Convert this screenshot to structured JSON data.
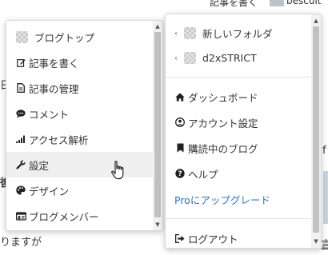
{
  "background": {
    "header_write": "記事を書く",
    "header_user": "bescuit",
    "left_char": "日",
    "left_char2": "後",
    "bottom_text": "りますが",
    "right_char": "f",
    "right_u": "言"
  },
  "left_menu": {
    "items": [
      {
        "label": "ブログトップ",
        "icon": "blog-thumbnail"
      },
      {
        "label": "記事を書く",
        "icon": "edit-icon"
      },
      {
        "label": "記事の管理",
        "icon": "document-icon"
      },
      {
        "label": "コメント",
        "icon": "comment-icon"
      },
      {
        "label": "アクセス解析",
        "icon": "chart-icon"
      },
      {
        "label": "設定",
        "icon": "wrench-icon"
      },
      {
        "label": "デザイン",
        "icon": "palette-icon"
      },
      {
        "label": "ブログメンバー",
        "icon": "members-icon"
      }
    ],
    "hovered_index": 5
  },
  "right_menu": {
    "folders": [
      {
        "label": "新しいフォルダ"
      },
      {
        "label": "d2xSTRICT"
      }
    ],
    "items": [
      {
        "label": "ダッシュボード",
        "icon": "home-icon"
      },
      {
        "label": "アカウント設定",
        "icon": "account-icon"
      },
      {
        "label": "購読中のブログ",
        "icon": "bookmark-icon"
      },
      {
        "label": "ヘルプ",
        "icon": "help-icon"
      }
    ],
    "upgrade_label": "Proにアップグレード",
    "logout_label": "ログアウト"
  },
  "colors": {
    "upgrade_link": "#2d74c4",
    "hover_bg": "#efefef"
  }
}
